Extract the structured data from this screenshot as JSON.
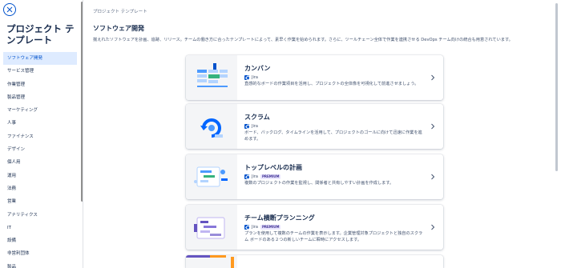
{
  "sidebar": {
    "title": "プロジェクト テンプレート",
    "items": [
      {
        "label": "ソフトウェア開発",
        "active": true
      },
      {
        "label": "サービス管理"
      },
      {
        "label": "作業管理"
      },
      {
        "label": "製品管理"
      },
      {
        "label": "マーケティング"
      },
      {
        "label": "人事"
      },
      {
        "label": "ファイナンス"
      },
      {
        "label": "デザイン"
      },
      {
        "label": "個人用"
      },
      {
        "label": "運用"
      },
      {
        "label": "法務"
      },
      {
        "label": "営業"
      },
      {
        "label": "アナリティクス"
      },
      {
        "label": "IT"
      },
      {
        "label": "設備"
      },
      {
        "label": "非営利団体"
      },
      {
        "label": "製品"
      }
    ]
  },
  "main": {
    "breadcrumb": "プロジェクト テンプレート",
    "title": "ソフトウェア開発",
    "description": "揃えれたソフトウェアを計画、追跡、リリース。チームの働き方に合ったテンプレートによって、素早く作業を始められます。さらに、ツールチェーン全体で作業を連携させる DevOps チーム向けの統合も用意されています。"
  },
  "templates": [
    {
      "title": "カンバン",
      "product": "Jira",
      "premium": false,
      "description": "直感的なボードの作業項目を活用し、プロジェクトの全体像を可視化して前進させましょう。",
      "icon": "kanban-board-icon"
    },
    {
      "title": "スクラム",
      "product": "Jira",
      "premium": false,
      "description": "ボード、バックログ、タイムラインを活用して、プロジェクトのゴールに向けて迅速に作業を進めます。",
      "icon": "scrum-sprint-icon"
    },
    {
      "title": "トップレベルの計画",
      "product": "Jira",
      "premium": true,
      "premium_label": "PREMIUM",
      "description": "複数のプロジェクトの作業を監視し、関係者と共有しやすい計画を作成します。",
      "icon": "top-level-plan-icon"
    },
    {
      "title": "チーム横断プランニング",
      "product": "Jira",
      "premium": true,
      "premium_label": "PREMIUM",
      "description": "プランを使用して複数のチームの作業を表示します。企業管理対象プロジェクトと独自のスクラム ボードのある２つの新しいチームに瞬時にアクセスします。",
      "icon": "cross-team-planning-icon"
    }
  ],
  "colors": {
    "accent": "#0052cc",
    "selected_bg": "#deebff",
    "premium_bg": "#eae6ff",
    "premium_text": "#403294"
  }
}
